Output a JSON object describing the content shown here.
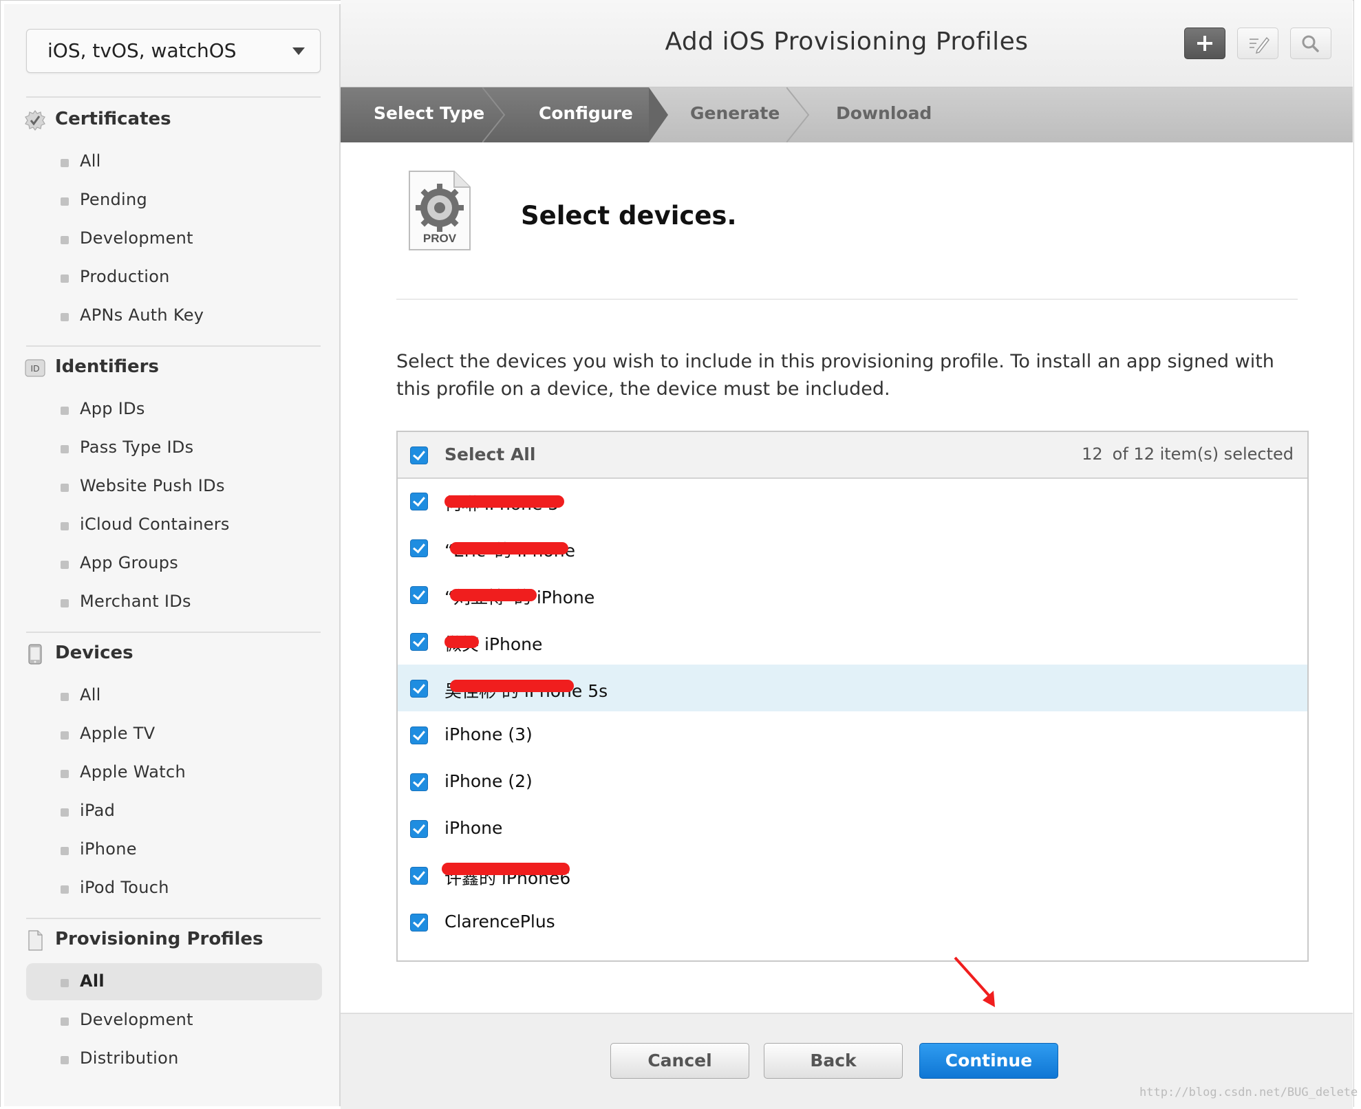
{
  "platform": {
    "label": "iOS, tvOS, watchOS"
  },
  "sidebar": {
    "sections": [
      {
        "title": "Certificates",
        "icon": "certificate-icon",
        "items": [
          "All",
          "Pending",
          "Development",
          "Production",
          "APNs Auth Key"
        ]
      },
      {
        "title": "Identifiers",
        "icon": "id-badge-icon",
        "badge": "ID",
        "items": [
          "App IDs",
          "Pass Type IDs",
          "Website Push IDs",
          "iCloud Containers",
          "App Groups",
          "Merchant IDs"
        ]
      },
      {
        "title": "Devices",
        "icon": "device-icon",
        "items": [
          "All",
          "Apple TV",
          "Apple Watch",
          "iPad",
          "iPhone",
          "iPod Touch"
        ]
      },
      {
        "title": "Provisioning Profiles",
        "icon": "document-icon",
        "items": [
          "All",
          "Development",
          "Distribution"
        ],
        "active_item": "All"
      }
    ]
  },
  "header": {
    "title": "Add iOS Provisioning Profiles"
  },
  "steps": [
    "Select Type",
    "Configure",
    "Generate",
    "Download"
  ],
  "content": {
    "icon_label": "PROV",
    "heading": "Select devices.",
    "description": "Select the devices you wish to include in this provisioning profile. To install an app signed with this profile on a device, the device must be included."
  },
  "device_list": {
    "select_all_label": "Select All",
    "selected_count": "12",
    "count_suffix": "of 12 item(s) selected",
    "devices": [
      {
        "name": "何琳 iPhone 5",
        "checked": true,
        "redacted": true
      },
      {
        "name": "“Eric”的 iPhone",
        "checked": true,
        "redacted": true
      },
      {
        "name": "“刘亚博”的 iPhone",
        "checked": true,
        "redacted": true
      },
      {
        "name": "微笑 iPhone",
        "checked": true,
        "redacted": true
      },
      {
        "name": "吴佳彬 的 iPhone 5s",
        "checked": true,
        "redacted": true,
        "highlighted": true
      },
      {
        "name": "iPhone (3)",
        "checked": true
      },
      {
        "name": "iPhone (2)",
        "checked": true
      },
      {
        "name": "iPhone",
        "checked": true
      },
      {
        "name": "许鑫的 iPhone6",
        "checked": true,
        "redacted": true
      },
      {
        "name": "ClarencePlus",
        "checked": true
      }
    ]
  },
  "footer": {
    "cancel": "Cancel",
    "back": "Back",
    "continue": "Continue"
  },
  "watermark": "http://blog.csdn.net/BUG_delete",
  "colors": {
    "accent": "#1f8de0",
    "step_done": "#6e6e6e",
    "highlight_row": "#e2f1f8",
    "annotation": "#f01e1e"
  }
}
